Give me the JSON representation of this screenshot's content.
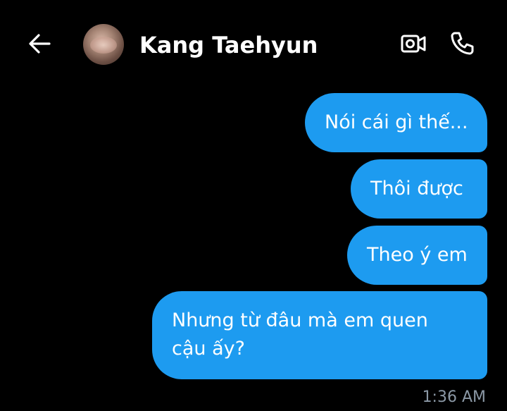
{
  "header": {
    "contact_name": "Kang Taehyun",
    "back_icon": "arrow-left-icon",
    "video_icon": "video-camera-icon",
    "call_icon": "phone-icon"
  },
  "messages": [
    {
      "text": "Nói cái gì thế...",
      "direction": "sent"
    },
    {
      "text": "Thôi được",
      "direction": "sent"
    },
    {
      "text": "Theo ý em",
      "direction": "sent"
    },
    {
      "text": "Nhưng từ đâu mà em quen cậu ấy?",
      "direction": "sent"
    }
  ],
  "timestamp": "1:36 AM",
  "colors": {
    "background": "#000000",
    "bubble": "#1d9bf0",
    "timestamp": "#8b98a5",
    "text": "#ffffff"
  }
}
